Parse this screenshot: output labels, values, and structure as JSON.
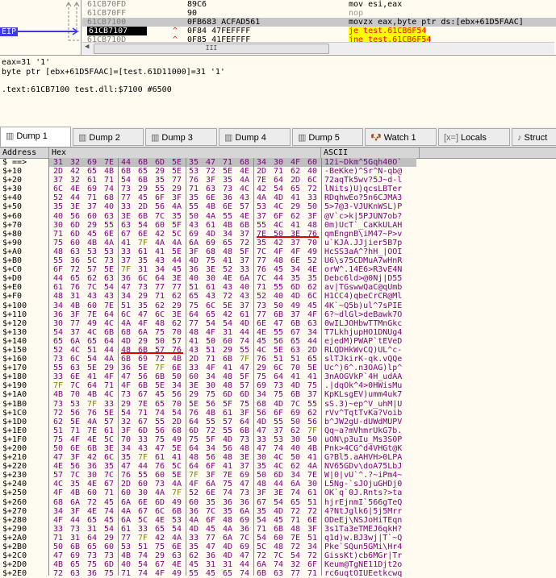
{
  "disasm": {
    "eip_label": "EIP",
    "rows": [
      {
        "addr": "61CB70FD",
        "bytes": "89C6",
        "arrow": "",
        "instr": "mov esi,eax"
      },
      {
        "addr": "61CB70FF",
        "bytes": "90",
        "arrow": "",
        "instr": "nop"
      },
      {
        "addr": "61CB7100",
        "bytes": "0FB683 ACFAD561",
        "arrow": "",
        "instr": "movzx eax,byte ptr ds:[ebx+61D5FAAC]"
      },
      {
        "addr": "61CB7107",
        "bytes": "0F84 47FEFFFF",
        "arrow": "^",
        "instr": "je test.61CB6F54"
      },
      {
        "addr": "61CB710D",
        "bytes": "0F85 41FEFFFF",
        "arrow": "^",
        "instr": "jne test.61CB6F54"
      }
    ],
    "scroll_grip": "III"
  },
  "info": {
    "line1": "eax=31 '1'",
    "line2": "byte ptr [ebx+61D5FAAC]=[test.61D11000]=31 '1'",
    "line3": ".text:61CB7100 test.dll:$7100 #6500"
  },
  "tabs": [
    {
      "label": "Dump 1",
      "icon": "memory-icon"
    },
    {
      "label": "Dump 2",
      "icon": "memory-icon"
    },
    {
      "label": "Dump 3",
      "icon": "memory-icon"
    },
    {
      "label": "Dump 4",
      "icon": "memory-icon"
    },
    {
      "label": "Dump 5",
      "icon": "memory-icon"
    },
    {
      "label": "Watch 1",
      "icon": "dog-icon"
    },
    {
      "label": "Locals",
      "icon": "variable-icon",
      "icon_text": "[x=]"
    },
    {
      "label": "Struct",
      "icon": "candy-cane-icon"
    }
  ],
  "dump": {
    "headers": {
      "address": "Address",
      "hex": "Hex",
      "ascii": "ASCII"
    },
    "rows": [
      {
        "a": "$ ==>",
        "h": "31 32 69 7E 44 6B 6D 5E 35 47 71 68 34 30 4F 60",
        "s": "12i~Dkm^5Gqh40O`"
      },
      {
        "a": "$+10",
        "h": "2D 42 65 4B 6B 65 29 5E 53 72 5E 4E 2D 71 62 40",
        "s": "-BeKke)^Sr^N-qb@"
      },
      {
        "a": "$+20",
        "h": "37 32 61 71 54 6B 35 77 76 3F 35 4A 7E 64 2D 6C",
        "s": "72aqTk5wv?5J~d-l"
      },
      {
        "a": "$+30",
        "h": "6C 4E 69 74 73 29 55 29 71 63 73 4C 42 54 65 72",
        "s": "lNits)U)qcsLBTer"
      },
      {
        "a": "$+40",
        "h": "52 44 71 68 77 45 6F 3F 35 6E 36 43 4A 4D 41 33",
        "s": "RDqhwEo?5n6CJMA3"
      },
      {
        "a": "$+50",
        "h": "35 3E 37 40 33 2D 56 4A 55 4B 6E 57 53 4C 29 50",
        "s": "5>7@3-VJUKnWSL)P"
      },
      {
        "a": "$+60",
        "h": "40 56 60 63 3E 6B 7C 35 50 4A 55 4E 37 6F 62 3F",
        "s": "@V`c>k|5PJUN7ob?"
      },
      {
        "a": "$+70",
        "h": "30 6D 29 55 63 54 60 5F 43 61 4B 6B 55 4C 41 48",
        "s": "0m)UcT`_CaKkULAH"
      },
      {
        "a": "$+80",
        "h": "71 6D 45 6E 67 6E 42 5C 69 4D 34 37 7E 50 3E 76",
        "s": "qmEngnB\\iM47~P>v"
      },
      {
        "a": "$+90",
        "h": "75 60 4B 4A 41 7F 4A 4A 6A 69 65 72 35 42 37 70",
        "s": "u`KJA.JJjier5B7p"
      },
      {
        "a": "$+A0",
        "h": "48 63 53 53 33 61 41 5E 3F 68 48 5F 7C 4F 4F 49",
        "s": "HcSS3aA^?hH_|OOI"
      },
      {
        "a": "$+B0",
        "h": "55 36 5C 73 37 35 43 44 4D 75 41 37 77 48 6E 52",
        "s": "U6\\s75CDMuA7wHnR"
      },
      {
        "a": "$+C0",
        "h": "6F 72 57 5E 7F 31 34 45 36 3E 52 33 76 45 34 4E",
        "s": "orW^.14E6>R3vE4N"
      },
      {
        "a": "$+D0",
        "h": "44 65 62 63 36 6C 64 3E 40 30 4E 6A 7C 44 35 35",
        "s": "Debc6ld>@0Nj|D55"
      },
      {
        "a": "$+E0",
        "h": "61 76 7C 54 47 73 77 77 51 61 43 40 71 55 6D 62",
        "s": "av|TGswwQaC@qUmb"
      },
      {
        "a": "$+F0",
        "h": "48 31 43 43 34 29 71 62 65 43 72 43 52 40 4D 6C",
        "s": "H1CC4)qbeCrCR@Ml"
      },
      {
        "a": "$+100",
        "h": "34 4B 60 7E 51 35 62 29 75 6C 5E 37 73 50 49 45",
        "s": "4K`~Q5b)ul^7sPIE"
      },
      {
        "a": "$+110",
        "h": "36 3F 7E 64 6C 47 6C 3E 64 65 42 61 77 6B 37 4F",
        "s": "6?~dlGl>deBawk7O"
      },
      {
        "a": "$+120",
        "h": "30 77 49 4C 4A 4F 48 62 77 54 54 4D 6E 47 6B 63",
        "s": "0wILJOHbwTTMnGkc"
      },
      {
        "a": "$+130",
        "h": "54 37 4C 6B 68 6A 75 70 48 4F 31 44 4E 55 67 34",
        "s": "T7LkhjupHO1DNUg4"
      },
      {
        "a": "$+140",
        "h": "65 6A 65 64 4D 29 50 57 41 50 60 74 45 56 65 44",
        "s": "ejedM)PWAP`tEVeD"
      },
      {
        "a": "$+150",
        "h": "52 4C 51 44 48 6B 57 76 43 51 29 55 4C 5E 63 2D",
        "s": "RLQDHkWvCQ)UL^c-"
      },
      {
        "a": "$+160",
        "h": "73 6C 54 4A 6B 69 72 4B 2D 71 6B 7F 76 51 51 65",
        "s": "slTJkirK-qk.vQQe"
      },
      {
        "a": "$+170",
        "h": "55 63 5E 29 36 5E 7F 6E 33 4F 41 47 29 6C 70 5E",
        "s": "Uc^)6^.n3OAG)lp^"
      },
      {
        "a": "$+180",
        "h": "33 6E 41 4F 47 56 6B 50 60 34 48 5F 75 64 41 41",
        "s": "3nAOGVkP`4H_udAA"
      },
      {
        "a": "$+190",
        "h": "7F 7C 64 71 4F 6B 5E 34 3E 30 48 57 69 73 4D 75",
        "s": ".|dqOk^4>0HWisMu"
      },
      {
        "a": "$+1A0",
        "h": "4B 70 4B 4C 73 67 45 56 29 75 6D 6D 34 75 6B 37",
        "s": "KpKLsgEV)umm4uk7"
      },
      {
        "a": "$+1B0",
        "h": "73 53 7F 33 29 7E 65 70 5E 56 5F 75 68 4D 7C 55",
        "s": "sS.3)~ep^V_uhM|U"
      },
      {
        "a": "$+1C0",
        "h": "72 56 76 5E 54 71 74 54 76 4B 61 3F 56 6F 69 62",
        "s": "rVv^TqtTvKa?Voib"
      },
      {
        "a": "$+1D0",
        "h": "62 5E 4A 57 32 67 55 2D 64 55 57 64 4D 55 50 56",
        "s": "b^JW2gU-dUWdMUPV"
      },
      {
        "a": "$+1E0",
        "h": "51 71 7E 61 3F 6D 56 68 6D 72 55 6B 47 37 62 7F",
        "s": "Qq~a?mVhmrUkG7b."
      },
      {
        "a": "$+1F0",
        "h": "75 4F 4E 5C 70 33 75 49 75 5F 4D 73 33 53 30 50",
        "s": "uON\\p3uIu_Ms3S0P"
      },
      {
        "a": "$+200",
        "h": "50 6E 6B 3E 34 43 47 5E 64 34 56 48 47 74 40 4B",
        "s": "Pnk>4CG^d4VHGt@K"
      },
      {
        "a": "$+210",
        "h": "47 3F 42 6C 35 7F 61 41 48 56 48 3E 30 4C 50 41",
        "s": "G?Bl5.aAHVH>0LPA"
      },
      {
        "a": "$+220",
        "h": "4E 56 36 35 47 44 76 5C 64 6F 41 37 35 4C 62 4A",
        "s": "NV65GDv\\doA75LbJ"
      },
      {
        "a": "$+230",
        "h": "57 7C 30 7C 76 55 60 5E 7F 3F 7E 69 50 6D 34 7E",
        "s": "W|0|vU`^.?~iPm4~"
      },
      {
        "a": "$+240",
        "h": "4C 35 4E 67 2D 60 73 4A 4F 6A 75 47 48 44 6A 30",
        "s": "L5Ng-`sJOjuGHDj0"
      },
      {
        "a": "$+250",
        "h": "4F 4B 60 71 60 30 4A 7F 52 6E 74 73 3F 3E 74 61",
        "s": "OK`q`0J.Rnts?>ta"
      },
      {
        "a": "$+260",
        "h": "68 6A 72 45 6A 6E 6D 49 60 35 36 36 67 54 65 51",
        "s": "hjrEjnmI`566gTeQ"
      },
      {
        "a": "$+270",
        "h": "34 3F 4E 74 4A 67 6C 6B 36 7C 35 6A 35 4D 72 72",
        "s": "4?NtJglk6|5j5Mrr"
      },
      {
        "a": "$+280",
        "h": "4F 44 65 45 6A 5C 4E 53 4A 6F 48 69 54 45 71 6E",
        "s": "ODeEj\\NSJoHiTEqn"
      },
      {
        "a": "$+290",
        "h": "33 73 31 54 61 33 65 54 4D 45 4A 36 71 6B 48 3F",
        "s": "3s1Ta3eTMEJ6qkH?"
      },
      {
        "a": "$+2A0",
        "h": "71 31 64 29 77 7F 42 4A 33 77 6A 7C 54 60 7E 51",
        "s": "q1d)w.BJ3wj|T`~Q"
      },
      {
        "a": "$+2B0",
        "h": "50 6B 65 60 53 51 75 6E 35 47 4D 69 5C 48 72 34",
        "s": "Pke`SQun5GMi\\Hr4"
      },
      {
        "a": "$+2C0",
        "h": "47 69 73 73 4B 74 29 63 62 36 4D 47 72 7C 54 72",
        "s": "GissKt)cb6MGr|Tr"
      },
      {
        "a": "$+2D0",
        "h": "4B 65 75 6D 40 54 67 4E 45 31 31 44 6A 74 32 6F",
        "s": "Keum@TgNE11Djt2o"
      },
      {
        "a": "$+2E0",
        "h": "72 63 36 75 71 74 4F 49 55 45 65 74 6B 63 77 71",
        "s": "rc6uqtOIUEetkcwq"
      }
    ]
  }
}
